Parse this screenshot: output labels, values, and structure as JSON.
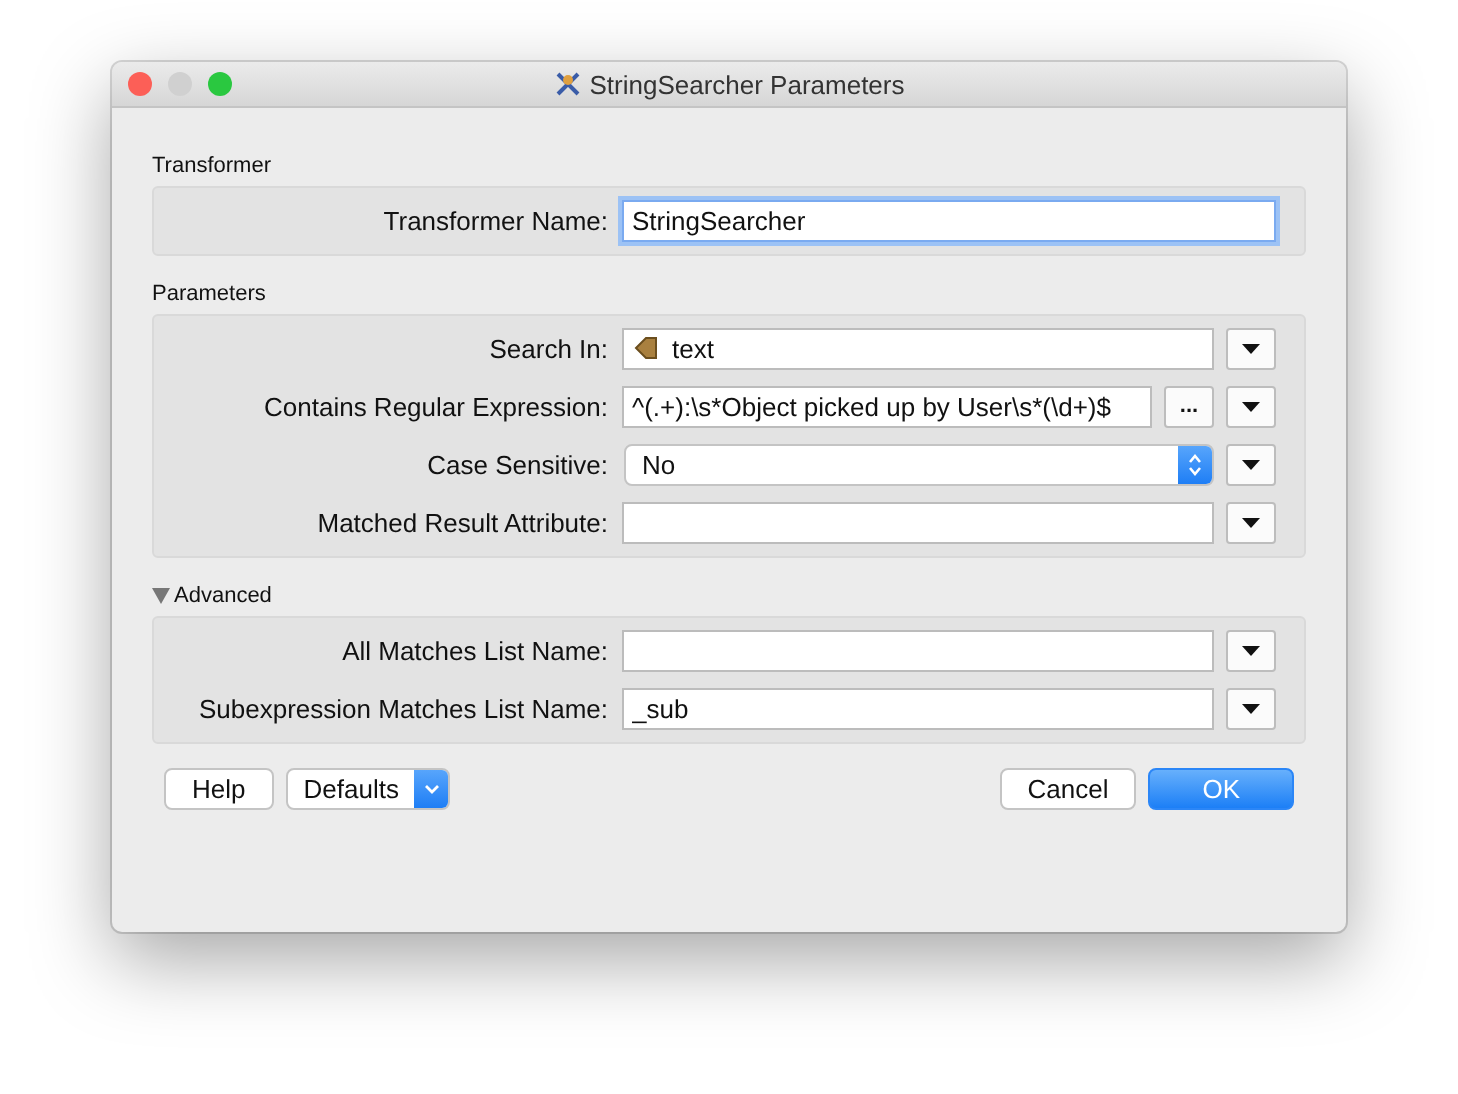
{
  "window": {
    "title": "StringSearcher Parameters"
  },
  "sections": [
    {
      "title": "Transformer",
      "rows": [
        {
          "kind": "name",
          "label": "Transformer Name:",
          "value": "StringSearcher",
          "focused": true
        }
      ]
    },
    {
      "title": "Parameters",
      "rows": [
        {
          "kind": "attribute",
          "label": "Search In:",
          "value": "text"
        },
        {
          "kind": "editor",
          "label": "Contains Regular Expression:",
          "value": "^(.+):\\s*Object picked up by User\\s*(\\d+)$",
          "button": "..."
        },
        {
          "kind": "select",
          "label": "Case Sensitive:",
          "value": "No"
        },
        {
          "kind": "text",
          "label": "Matched Result Attribute:",
          "value": ""
        }
      ]
    },
    {
      "title": "Advanced",
      "expanded": true,
      "rows": [
        {
          "kind": "text",
          "label": "All Matches List Name:",
          "value": ""
        },
        {
          "kind": "text",
          "label": "Subexpression Matches List Name:",
          "value": "_sub"
        }
      ]
    }
  ],
  "footer": {
    "help": "Help",
    "defaults": "Defaults",
    "cancel": "Cancel",
    "ok": "OK"
  }
}
